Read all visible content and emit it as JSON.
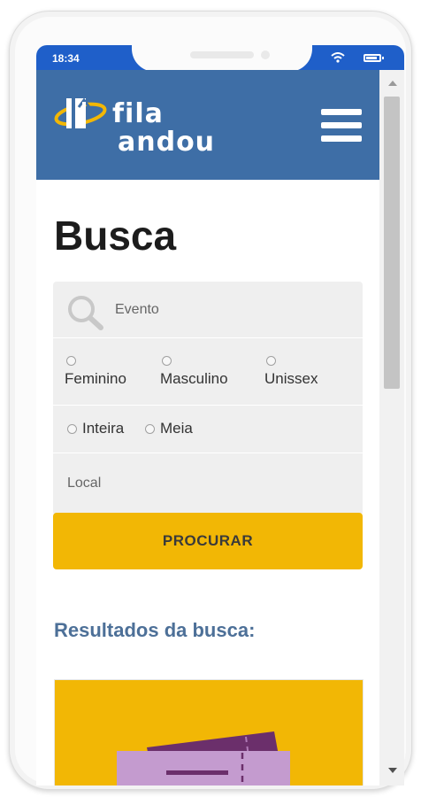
{
  "status_bar": {
    "time": "18:34"
  },
  "header": {
    "logo_line1": "fila",
    "logo_line2": "andou"
  },
  "page": {
    "title": "Busca"
  },
  "search": {
    "placeholder": "Evento",
    "gender_options": [
      "Feminino",
      "Masculino",
      "Unissex"
    ],
    "ticket_options": [
      "Inteira",
      "Meia"
    ],
    "local_placeholder": "Local",
    "submit_label": "PROCURAR"
  },
  "results": {
    "title": "Resultados da busca:"
  },
  "colors": {
    "status_bar": "#1f5fc9",
    "header": "#3e6ea6",
    "accent_button": "#f2b705",
    "results_title": "#4d7098",
    "ticket": "#c49bcf"
  }
}
